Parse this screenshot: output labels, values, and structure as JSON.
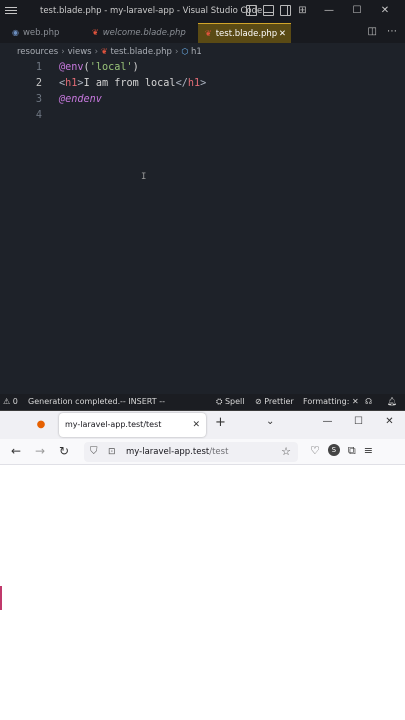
{
  "vscode": {
    "window_title": "test.blade.php - my-laravel-app - Visual Studio Code",
    "window_controls": {
      "minimize": "—",
      "maximize": "☐",
      "close": "✕"
    },
    "tabs": [
      {
        "label": "web.php",
        "icon": "php-file-icon",
        "active": false,
        "italic": false
      },
      {
        "label": "welcome.blade.php",
        "icon": "blade-file-icon",
        "active": false,
        "italic": true
      },
      {
        "label": "test.blade.php",
        "icon": "blade-file-icon",
        "active": true,
        "italic": false,
        "close": "✕"
      }
    ],
    "breadcrumb": [
      "resources",
      "views",
      "test.blade.php",
      "h1"
    ],
    "breadcrumb_sep": "›",
    "editor": {
      "lines": [
        {
          "number": "1",
          "parts": {
            "dir": "@env",
            "open": "(",
            "str": "'local'",
            "close": ")"
          }
        },
        {
          "number": "2",
          "parts": {
            "lt1": "<",
            "tag1": "h1",
            "gt1": ">",
            "text": "I am from local",
            "lt2": "</",
            "tag2": "h1",
            "gt2": ">"
          }
        },
        {
          "number": "3",
          "parts": {
            "dir": "@endenv"
          }
        },
        {
          "number": "4",
          "parts": {}
        }
      ],
      "current_line": "2"
    },
    "statusbar": {
      "warnings": "⚠ 0",
      "message": "Generation completed.",
      "mode": "-- INSERT --",
      "spell": "Spell",
      "prettier": "Prettier",
      "formatting": "Formatting: ✕"
    }
  },
  "firefox": {
    "tab_title": "my-laravel-app.test/test",
    "tab_close": "✕",
    "new_tab": "+",
    "list_all_tabs": "⌄",
    "window_controls": {
      "minimize": "—",
      "maximize": "☐",
      "close": "✕"
    },
    "url": {
      "host": "my-laravel-app.test",
      "path": "/test"
    },
    "nav": {
      "back": "←",
      "forward": "→",
      "reload": "↻"
    }
  },
  "colors": {
    "active_tab_bg": "#5a4a14",
    "active_tab_border": "#d1a52a",
    "directive": "#c678dd",
    "string": "#98c379",
    "tag": "#e06c75"
  }
}
